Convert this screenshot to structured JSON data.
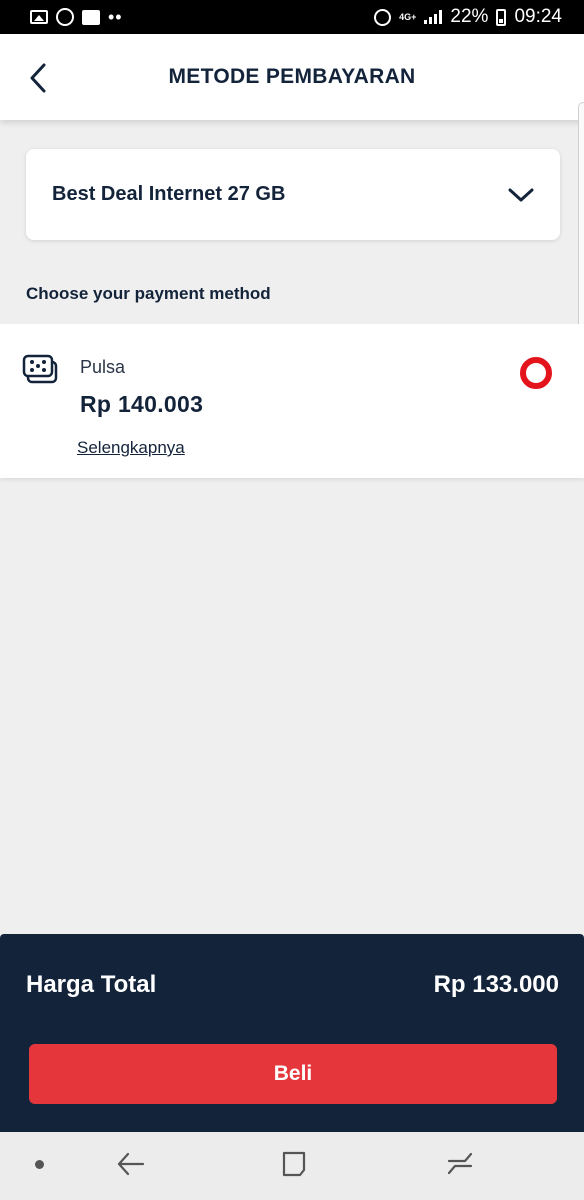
{
  "status_bar": {
    "battery": "22%",
    "time": "09:24",
    "network": "4G+",
    "icons": [
      "image-icon",
      "whatsapp-icon",
      "message-icon",
      "more-dots-icon",
      "alarm-icon",
      "signal-icon",
      "battery-icon"
    ]
  },
  "header": {
    "title": "METODE PEMBAYARAN",
    "back_icon": "chevron-left-icon"
  },
  "package": {
    "name": "Best Deal Internet 27 GB",
    "dropdown_icon": "chevron-down-icon"
  },
  "payment": {
    "section_label": "Choose your payment method",
    "options": [
      {
        "name": "Pulsa",
        "amount": "Rp 140.003",
        "more_label": "Selengkapnya",
        "icon": "sim-card-icon",
        "selected": true
      }
    ]
  },
  "footer": {
    "total_label": "Harga Total",
    "total_value": "Rp 133.000",
    "buy_label": "Beli"
  },
  "colors": {
    "primary_navy": "#13233a",
    "accent_red": "#e4141d",
    "button_red": "#e5373b",
    "background": "#efefef"
  },
  "nav_bar": {
    "icons": [
      "dot-icon",
      "nav-back-icon",
      "nav-home-icon",
      "nav-recent-icon"
    ]
  }
}
